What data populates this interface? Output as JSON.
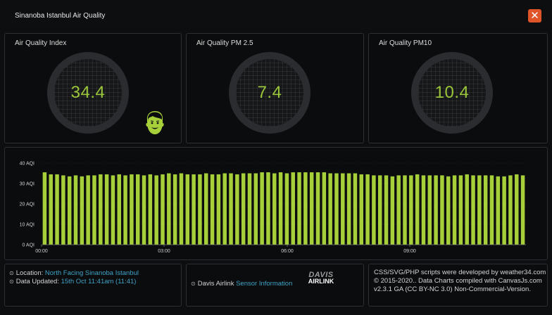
{
  "window": {
    "title": "Sinanoba Istanbul Air Quality",
    "close_label": "✕"
  },
  "panels": {
    "aqi": {
      "title": "Air Quality Index",
      "value": "34.4"
    },
    "pm25": {
      "title": "Air Quality PM 2.5",
      "value": "7.4"
    },
    "pm10": {
      "title": "Air Quality PM10",
      "value": "10.4"
    }
  },
  "colors": {
    "accent": "#9bc63a",
    "bar": "#a6cf3a",
    "link": "#3fa3c8",
    "close": "#e0542a"
  },
  "chart_data": {
    "type": "bar",
    "y_unit": "AQI",
    "ylim": [
      0,
      40
    ],
    "y_ticks": [
      "0 AQI",
      "10 AQI",
      "20 AQI",
      "30 AQI",
      "40 AQI"
    ],
    "x_ticks": [
      "00:00",
      "03:00",
      "06:00",
      "09:00"
    ],
    "grid": true,
    "values": [
      35.5,
      34.5,
      34.5,
      34,
      33.5,
      34,
      33.5,
      34,
      34,
      34.5,
      34.5,
      34,
      34.5,
      34,
      34.5,
      34.5,
      34,
      34.5,
      34,
      34.5,
      35,
      34.5,
      35,
      34.5,
      34.5,
      34.5,
      35,
      34.5,
      34.5,
      35,
      35,
      34.5,
      35,
      35,
      35,
      35.5,
      35.5,
      35,
      35.5,
      35,
      35.5,
      35.5,
      35.5,
      35.5,
      35.5,
      35.5,
      35,
      35,
      35,
      35,
      35,
      34.5,
      34.5,
      34,
      34,
      34,
      33.5,
      34,
      34,
      34,
      34.5,
      34,
      34,
      34,
      34,
      33.5,
      34,
      34,
      34.5,
      34,
      34,
      34,
      34,
      33.5,
      33.5,
      34,
      34.5,
      34
    ]
  },
  "footer": {
    "location_label": "Location:",
    "location_value": "North Facing Sinanoba Istanbul",
    "updated_label": "Data Updated:",
    "updated_value": "15th Oct 11:41am (11:41)",
    "sensor_label": "Davis Airlink",
    "sensor_link": "Sensor Information",
    "logo_top": "DAVIS",
    "logo_bottom": "AIRLINK",
    "credits": "CSS/SVG/PHP scripts were developed by weather34.com © 2015-2020.. Data Charts compiled with CanvasJs.com v2.3.1 GA (CC BY-NC 3.0) Non-Commercial-Version."
  }
}
